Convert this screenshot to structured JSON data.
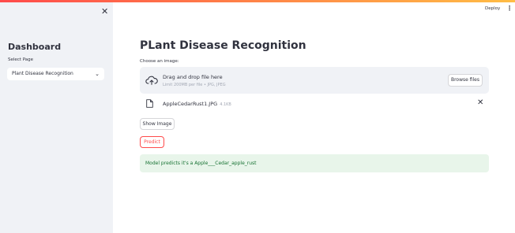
{
  "colors": {
    "accent": "#ff4b4b",
    "sidebar_bg": "#f0f2f6",
    "success_bg": "#e8f5ea",
    "success_text": "#177233"
  },
  "sidebar": {
    "close_icon": "close-icon",
    "title": "Dashboard",
    "select_label": "Select Page",
    "selected_page": "Plant Disease Recognition"
  },
  "header": {
    "deploy_label": "Deploy",
    "menu_icon": "vertical-ellipsis-icon"
  },
  "main": {
    "title": "PLant Disease Recognition",
    "uploader": {
      "label": "Choose an image:",
      "drop_title": "Drag and drop file here",
      "limit_text": "Limit 200MB per file • JPG, JPEG",
      "browse_label": "Browse files"
    },
    "file": {
      "name": "AppleCedarRust1.JPG",
      "size": "4.1KB"
    },
    "show_image_label": "Show Image",
    "predict_label": "Predict",
    "result_text": "Model predicts it's a Apple___Cedar_apple_rust"
  }
}
